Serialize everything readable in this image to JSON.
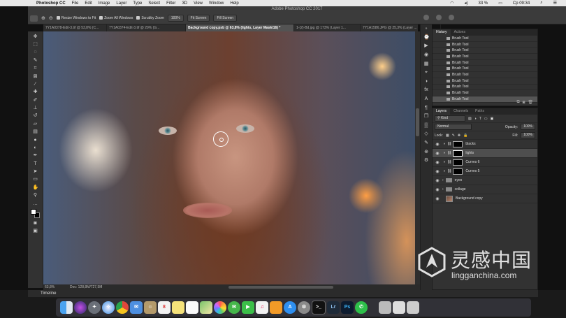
{
  "menubar": {
    "app": "Photoshop CC",
    "items": [
      "File",
      "Edit",
      "Image",
      "Layer",
      "Type",
      "Select",
      "Filter",
      "3D",
      "View",
      "Window",
      "Help"
    ],
    "battery": "33 %",
    "clock": "Ср 09:34"
  },
  "window_title": "Adobe Photoshop CC 2017",
  "options": {
    "resize_windows": "Resize Windows to Fit",
    "zoom_all": "Zoom All Windows",
    "scrubby": "Scrubby Zoom",
    "zoom_pct": "100%",
    "fit_screen": "Fit Screen",
    "fill_screen": "Fill Screen"
  },
  "tabs": [
    {
      "label": "7Y1A0378-Edit-3.tif @ 53,8% (C...",
      "active": false
    },
    {
      "label": "7Y1A0374-Edit-3.tif @ 29% (G...",
      "active": false
    },
    {
      "label": "Background copy.psb @ 63,8% (lights, Layer Mask/16) *",
      "active": true
    },
    {
      "label": "1-(2)-Bd.jpg @ 173% (Layer 1...",
      "active": false
    },
    {
      "label": "7Y1A1586.JPG @ 25,3% (Layer ...",
      "active": false
    }
  ],
  "status": {
    "zoom": "63,8%",
    "doc": "Doc: 128,8M/727,5M"
  },
  "history": {
    "tabs": [
      "History",
      "Actions"
    ],
    "items": [
      "Brush Tool",
      "Brush Tool",
      "Brush Tool",
      "Brush Tool",
      "Brush Tool",
      "Brush Tool",
      "Brush Tool",
      "Brush Tool",
      "Brush Tool",
      "Brush Tool",
      "Brush Tool"
    ]
  },
  "layers_panel": {
    "tabs": [
      "Layers",
      "Channels",
      "Paths"
    ],
    "kind": "Kind",
    "blend": "Normal",
    "opacity_label": "Opacity:",
    "opacity": "100%",
    "lock_label": "Lock:",
    "fill_label": "Fill:",
    "fill": "100%",
    "layers": [
      {
        "name": "blacks",
        "type": "adjust",
        "active": false
      },
      {
        "name": "lights",
        "type": "adjust",
        "active": true
      },
      {
        "name": "Curves 6",
        "type": "adjust",
        "active": false
      },
      {
        "name": "Curves 5",
        "type": "adjust",
        "active": false
      },
      {
        "name": "eyes",
        "type": "group",
        "active": false
      },
      {
        "name": "collage",
        "type": "group",
        "active": false
      },
      {
        "name": "Background copy",
        "type": "image",
        "active": false
      }
    ]
  },
  "timeline_label": "Timeline",
  "dock": {
    "icons": [
      "finder",
      "siri",
      "launchpad",
      "safari",
      "chrome",
      "mail",
      "contacts",
      "calendar",
      "notes",
      "reminders",
      "maps",
      "photos",
      "messages",
      "facetime",
      "itunes",
      "ibooks",
      "appstore",
      "preferences",
      "terminal",
      "lightroom",
      "photoshop",
      "whatsapp"
    ]
  },
  "watermark": {
    "cn": "灵感中国",
    "en": "lingganchina.com"
  }
}
